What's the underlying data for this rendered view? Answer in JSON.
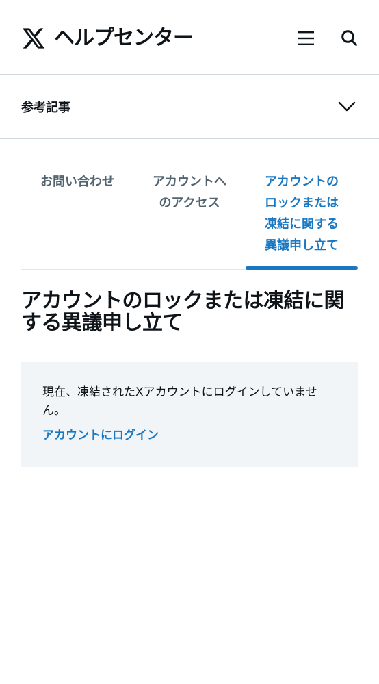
{
  "header": {
    "site_title": "ヘルプセンター",
    "logo_icon": "x-logo-icon",
    "menu_icon": "hamburger-menu-icon",
    "search_icon": "search-icon"
  },
  "reference_bar": {
    "label": "参考記事",
    "toggle_icon": "chevron-down-icon"
  },
  "tabs": [
    {
      "label": "お問い合わせ",
      "active": false
    },
    {
      "label": "アカウントへのアクセス",
      "active": false
    },
    {
      "label": "アカウントのロックまたは凍結に関する異議申し立て",
      "active": true
    }
  ],
  "page": {
    "title": "アカウントのロックまたは凍結に関する異議申し立て"
  },
  "notice": {
    "message": "現在、凍結されたXアカウントにログインしていません。",
    "login_link": "アカウントにログイン"
  },
  "colors": {
    "accent": "#1a78c2",
    "text": "#0f1419",
    "muted": "#536471",
    "notice_bg": "#f1f5f8",
    "border": "#cfd9de"
  }
}
